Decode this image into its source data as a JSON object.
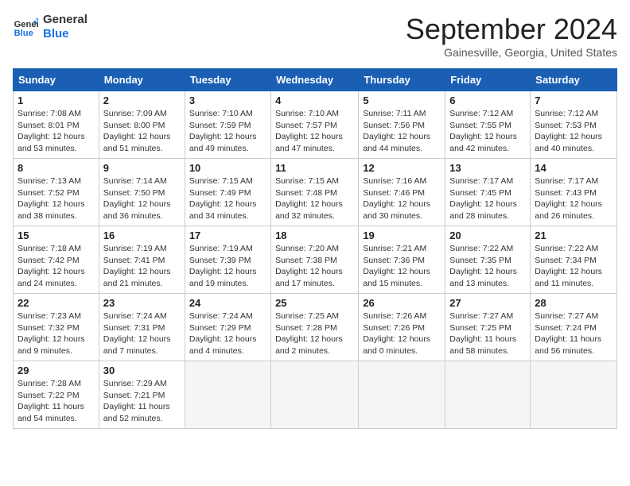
{
  "header": {
    "logo_line1": "General",
    "logo_line2": "Blue",
    "title": "September 2024",
    "subtitle": "Gainesville, Georgia, United States"
  },
  "weekdays": [
    "Sunday",
    "Monday",
    "Tuesday",
    "Wednesday",
    "Thursday",
    "Friday",
    "Saturday"
  ],
  "weeks": [
    [
      {
        "day": "1",
        "sunrise": "7:08 AM",
        "sunset": "8:01 PM",
        "daylight": "12 hours and 53 minutes."
      },
      {
        "day": "2",
        "sunrise": "7:09 AM",
        "sunset": "8:00 PM",
        "daylight": "12 hours and 51 minutes."
      },
      {
        "day": "3",
        "sunrise": "7:10 AM",
        "sunset": "7:59 PM",
        "daylight": "12 hours and 49 minutes."
      },
      {
        "day": "4",
        "sunrise": "7:10 AM",
        "sunset": "7:57 PM",
        "daylight": "12 hours and 47 minutes."
      },
      {
        "day": "5",
        "sunrise": "7:11 AM",
        "sunset": "7:56 PM",
        "daylight": "12 hours and 44 minutes."
      },
      {
        "day": "6",
        "sunrise": "7:12 AM",
        "sunset": "7:55 PM",
        "daylight": "12 hours and 42 minutes."
      },
      {
        "day": "7",
        "sunrise": "7:12 AM",
        "sunset": "7:53 PM",
        "daylight": "12 hours and 40 minutes."
      }
    ],
    [
      {
        "day": "8",
        "sunrise": "7:13 AM",
        "sunset": "7:52 PM",
        "daylight": "12 hours and 38 minutes."
      },
      {
        "day": "9",
        "sunrise": "7:14 AM",
        "sunset": "7:50 PM",
        "daylight": "12 hours and 36 minutes."
      },
      {
        "day": "10",
        "sunrise": "7:15 AM",
        "sunset": "7:49 PM",
        "daylight": "12 hours and 34 minutes."
      },
      {
        "day": "11",
        "sunrise": "7:15 AM",
        "sunset": "7:48 PM",
        "daylight": "12 hours and 32 minutes."
      },
      {
        "day": "12",
        "sunrise": "7:16 AM",
        "sunset": "7:46 PM",
        "daylight": "12 hours and 30 minutes."
      },
      {
        "day": "13",
        "sunrise": "7:17 AM",
        "sunset": "7:45 PM",
        "daylight": "12 hours and 28 minutes."
      },
      {
        "day": "14",
        "sunrise": "7:17 AM",
        "sunset": "7:43 PM",
        "daylight": "12 hours and 26 minutes."
      }
    ],
    [
      {
        "day": "15",
        "sunrise": "7:18 AM",
        "sunset": "7:42 PM",
        "daylight": "12 hours and 24 minutes."
      },
      {
        "day": "16",
        "sunrise": "7:19 AM",
        "sunset": "7:41 PM",
        "daylight": "12 hours and 21 minutes."
      },
      {
        "day": "17",
        "sunrise": "7:19 AM",
        "sunset": "7:39 PM",
        "daylight": "12 hours and 19 minutes."
      },
      {
        "day": "18",
        "sunrise": "7:20 AM",
        "sunset": "7:38 PM",
        "daylight": "12 hours and 17 minutes."
      },
      {
        "day": "19",
        "sunrise": "7:21 AM",
        "sunset": "7:36 PM",
        "daylight": "12 hours and 15 minutes."
      },
      {
        "day": "20",
        "sunrise": "7:22 AM",
        "sunset": "7:35 PM",
        "daylight": "12 hours and 13 minutes."
      },
      {
        "day": "21",
        "sunrise": "7:22 AM",
        "sunset": "7:34 PM",
        "daylight": "12 hours and 11 minutes."
      }
    ],
    [
      {
        "day": "22",
        "sunrise": "7:23 AM",
        "sunset": "7:32 PM",
        "daylight": "12 hours and 9 minutes."
      },
      {
        "day": "23",
        "sunrise": "7:24 AM",
        "sunset": "7:31 PM",
        "daylight": "12 hours and 7 minutes."
      },
      {
        "day": "24",
        "sunrise": "7:24 AM",
        "sunset": "7:29 PM",
        "daylight": "12 hours and 4 minutes."
      },
      {
        "day": "25",
        "sunrise": "7:25 AM",
        "sunset": "7:28 PM",
        "daylight": "12 hours and 2 minutes."
      },
      {
        "day": "26",
        "sunrise": "7:26 AM",
        "sunset": "7:26 PM",
        "daylight": "12 hours and 0 minutes."
      },
      {
        "day": "27",
        "sunrise": "7:27 AM",
        "sunset": "7:25 PM",
        "daylight": "11 hours and 58 minutes."
      },
      {
        "day": "28",
        "sunrise": "7:27 AM",
        "sunset": "7:24 PM",
        "daylight": "11 hours and 56 minutes."
      }
    ],
    [
      {
        "day": "29",
        "sunrise": "7:28 AM",
        "sunset": "7:22 PM",
        "daylight": "11 hours and 54 minutes."
      },
      {
        "day": "30",
        "sunrise": "7:29 AM",
        "sunset": "7:21 PM",
        "daylight": "11 hours and 52 minutes."
      },
      null,
      null,
      null,
      null,
      null
    ]
  ]
}
